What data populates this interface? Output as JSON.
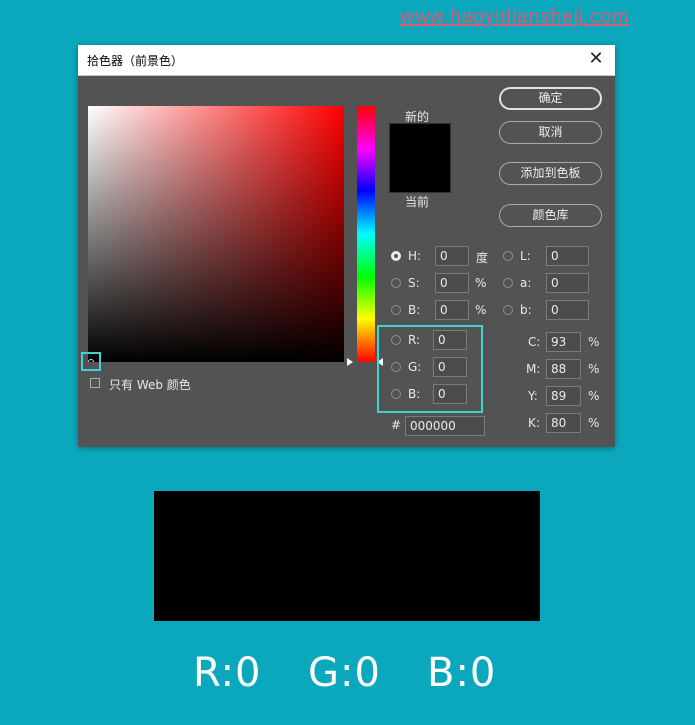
{
  "watermark": "www.haoyidiansheji.com",
  "dialog": {
    "title": "拾色器（前景色）",
    "close_glyph": "✕",
    "new_label": "新的",
    "current_label": "当前",
    "new_color": "#000000",
    "current_color": "#000000",
    "buttons": {
      "ok": "确定",
      "cancel": "取消",
      "add_to_swatches": "添加到色板",
      "color_libraries": "颜色库"
    },
    "web_only_label": "只有 Web 颜色",
    "hsb": {
      "h_label": "H:",
      "h_value": "0",
      "h_unit": "度",
      "s_label": "S:",
      "s_value": "0",
      "s_unit": "%",
      "b_label": "B:",
      "b_value": "0",
      "b_unit": "%"
    },
    "lab": {
      "l_label": "L:",
      "l_value": "0",
      "a_label": "a:",
      "a_value": "0",
      "b_label": "b:",
      "b_value": "0"
    },
    "rgb": {
      "r_label": "R:",
      "r_value": "0",
      "g_label": "G:",
      "g_value": "0",
      "b_label": "B:",
      "b_value": "0"
    },
    "hex": {
      "label": "#",
      "value": "000000"
    },
    "cmyk": {
      "c_label": "C:",
      "c_value": "93",
      "m_label": "M:",
      "m_value": "88",
      "y_label": "Y:",
      "y_value": "89",
      "k_label": "K:",
      "k_value": "80",
      "unit": "%"
    }
  },
  "caption": {
    "r": "R:0",
    "g": "G:0",
    "b": "B:0"
  },
  "colors": {
    "background": "#0ba8bd",
    "highlight": "#3ed1d6",
    "dialog_bg": "#535353"
  }
}
